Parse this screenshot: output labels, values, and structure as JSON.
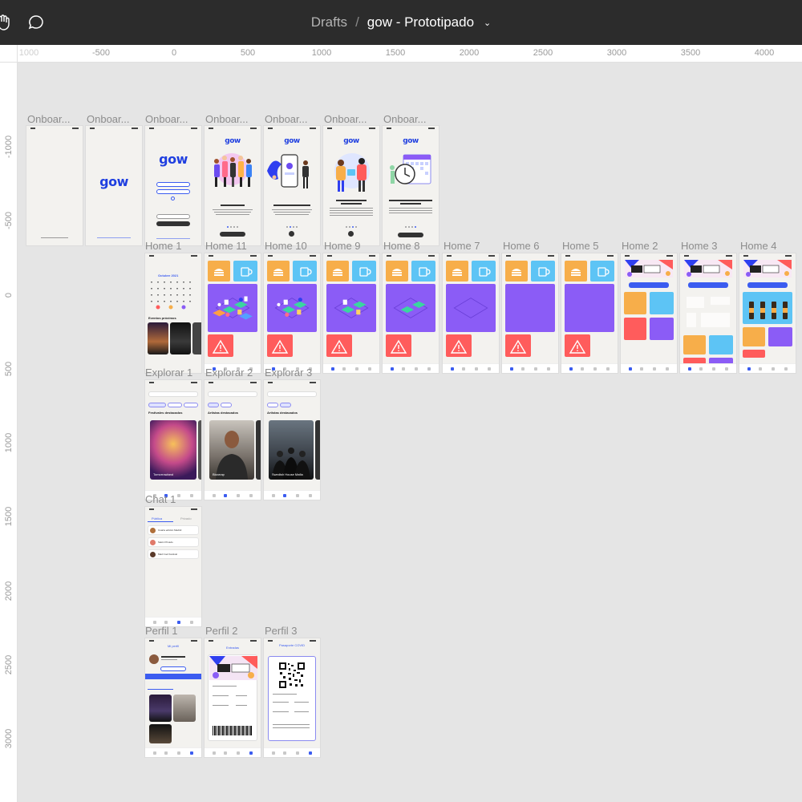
{
  "toolbar": {
    "breadcrumb_root": "Drafts",
    "separator": "/",
    "file_name": "gow - Prototipado",
    "hand_icon": "hand-tool-icon",
    "comment_icon": "comment-icon",
    "chevron_icon": "chevron-down-icon"
  },
  "ruler": {
    "top_labels": [
      "1000",
      "-500",
      "0",
      "500",
      "1000",
      "1500",
      "2000",
      "2500",
      "3000",
      "3500",
      "4000"
    ],
    "left_labels": [
      "-1000",
      "-500",
      "0",
      "500",
      "1000",
      "1500",
      "2000",
      "2500",
      "3000"
    ]
  },
  "colors": {
    "accent": "#1f3fe0",
    "toolbar_bg": "#2c2c2c",
    "canvas_bg": "#e5e5e5",
    "tile_orange": "#f7ae4a",
    "tile_blue": "#5dc4f5",
    "tile_purple": "#8b5cf6",
    "tile_red": "#ff5c5c"
  },
  "frames": {
    "onboarding": [
      "Onboar...",
      "Onboar...",
      "Onboar...",
      "Onboar...",
      "Onboar...",
      "Onboar...",
      "Onboar..."
    ],
    "home": [
      "Home 1",
      "Home 11",
      "Home 10",
      "Home 9",
      "Home 8",
      "Home 7",
      "Home 6",
      "Home 5",
      "Home 2",
      "Home 3",
      "Home 4"
    ],
    "explorar": [
      "Explorar 1",
      "Explorar 2",
      "Explorar 3"
    ],
    "chat": [
      "Chat 1"
    ],
    "perfil": [
      "Perfil 1",
      "Perfil 2",
      "Perfil 3"
    ]
  },
  "content": {
    "logo": "gow",
    "onboard_calendar": "Octubre 2021",
    "onboard_headline_1": "Bienvenid@s",
    "onboard_headline_2": "Encuentra a tus amigos",
    "onboard_headline_3": "Nos preocupamos por tu salud",
    "onboard_headline_4": "La organización es lo más importante",
    "events_heading": "Eventos próximos",
    "featured_festivals": "Festivales destacados",
    "featured_artists": "Artistas destacados",
    "festival_name": "Tomorrowland",
    "artist_1": "Bizarrap",
    "artist_2": "Swedish House Mafia",
    "chat_tab_public": "Pública",
    "chat_tab_private": "Privado",
    "chat_rows": [
      "Cuarta edición Madrid",
      "Salón Privado",
      "Mad Cool Festival"
    ],
    "profile_title": "Mi perfil",
    "tickets_title": "Entradas",
    "passport_title": "Pasaporte COVID"
  }
}
